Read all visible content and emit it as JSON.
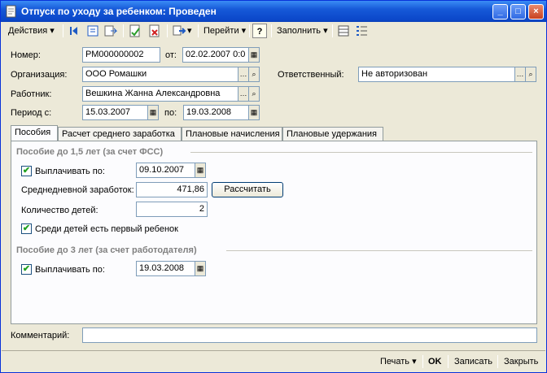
{
  "window": {
    "title": "Отпуск по уходу за ребенком: Проведен"
  },
  "toolbar": {
    "actions": "Действия",
    "goto": "Перейти",
    "help": "?",
    "fill": "Заполнить"
  },
  "form": {
    "number_label": "Номер:",
    "number_value": "РМ000000002",
    "from_label": "от:",
    "from_value": "02.02.2007 0:0",
    "org_label": "Организация:",
    "org_value": "ООО Ромашки",
    "responsible_label": "Ответственный:",
    "responsible_value": "Не авторизован",
    "employee_label": "Работник:",
    "employee_value": "Вешкина Жанна Александровна",
    "period_label": "Период с:",
    "period_from": "15.03.2007",
    "period_to_label": "по:",
    "period_to": "19.03.2008"
  },
  "tabs": [
    "Пособия",
    "Расчет среднего заработка",
    "Плановые начисления",
    "Плановые удержания"
  ],
  "benefits": {
    "group1_title": "Пособие до 1,5 лет (за счет ФСС)",
    "pay_until_label": "Выплачивать по:",
    "pay_until_value": "09.10.2007",
    "avg_daily_label": "Среднедневной заработок:",
    "avg_daily_value": "471,86",
    "calc_button": "Рассчитать",
    "children_label": "Количество детей:",
    "children_value": "2",
    "first_child_label": "Среди детей есть первый ребенок",
    "group2_title": "Пособие до 3 лет (за счет работодателя)",
    "pay_until2_label": "Выплачивать по:",
    "pay_until2_value": "19.03.2008"
  },
  "comment": {
    "label": "Комментарий:",
    "value": ""
  },
  "footer": {
    "print": "Печать",
    "ok": "OK",
    "save": "Записать",
    "close": "Закрыть"
  },
  "colors": {
    "title_bar": "#0b47c9",
    "window_bg": "#ece9d8",
    "panel_bg": "#fcfcfe",
    "group_title": "#808080"
  }
}
